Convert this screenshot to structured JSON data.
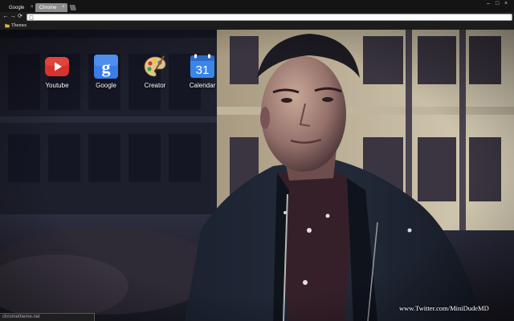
{
  "tabs": [
    {
      "title": "Google",
      "close": "×",
      "active": false
    },
    {
      "title": "Chrome",
      "close": "×",
      "active": true
    }
  ],
  "window_controls": {
    "minimize": "–",
    "maximize": "□",
    "close": "×"
  },
  "toolbar": {
    "back": "←",
    "forward": "→",
    "reload": "⟳",
    "omnibox_value": ""
  },
  "bookmarks": [
    {
      "label": "Themes",
      "icon": "folder-icon"
    }
  ],
  "apps": [
    {
      "label": "Youtube",
      "icon": "youtube-icon"
    },
    {
      "label": "Google",
      "icon": "google-icon"
    },
    {
      "label": "Creator",
      "icon": "palette-icon"
    },
    {
      "label": "Calendar",
      "icon": "calendar-icon",
      "day": "31"
    }
  ],
  "watermark": "www.Twitter.com/MiniDudeMD",
  "status_text": "chrometheme.net",
  "colors": {
    "youtube_red": "#d8322c",
    "google_blue": "#3b7de8",
    "calendar_blue": "#3a86e8",
    "chrome_dark": "#1c1c1c",
    "tab_active": "#8c8c8c"
  }
}
